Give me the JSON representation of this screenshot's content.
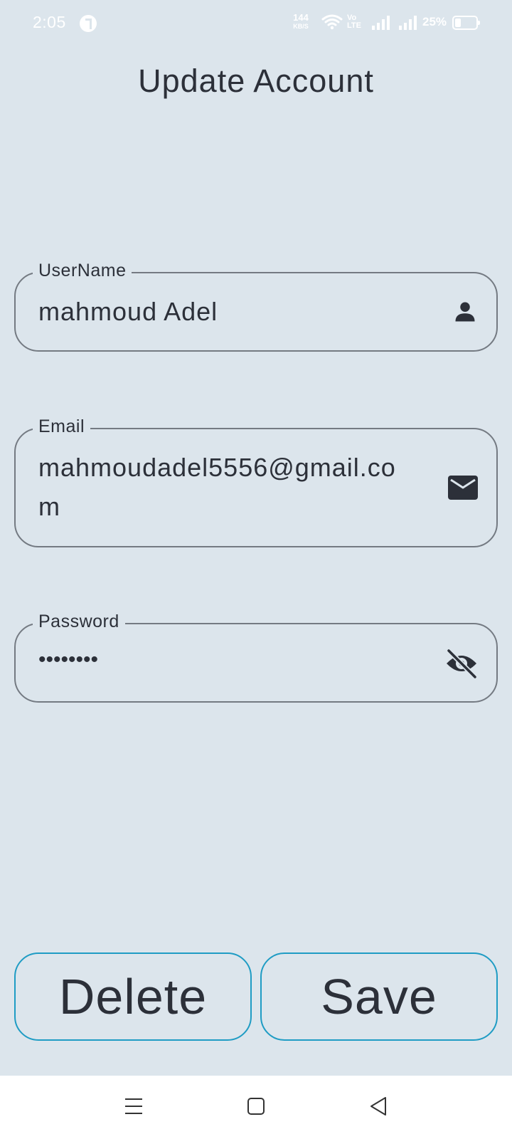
{
  "status_bar": {
    "time": "2:05",
    "net_speed_value": "144",
    "net_speed_unit": "KB/S",
    "volte_top": "Vo",
    "volte_bottom": "LTE",
    "battery": "25%"
  },
  "header": {
    "title": "Update Account"
  },
  "form": {
    "username": {
      "label": "UserName",
      "value": "mahmoud Adel",
      "icon": "person-icon"
    },
    "email": {
      "label": "Email",
      "value": "mahmoudadel5556@gmail.com",
      "icon": "mail-icon"
    },
    "password": {
      "label": "Password",
      "value": "••••••••",
      "icon": "visibility-off-icon"
    }
  },
  "actions": {
    "delete_label": "Delete",
    "save_label": "Save",
    "border_color": "#1f9cc4"
  },
  "colors": {
    "background": "#dce5ec",
    "text": "#2c3039",
    "field_border": "#747a82"
  },
  "nav_bar": {
    "icons": [
      "menu-icon",
      "home-icon",
      "back-icon"
    ]
  }
}
